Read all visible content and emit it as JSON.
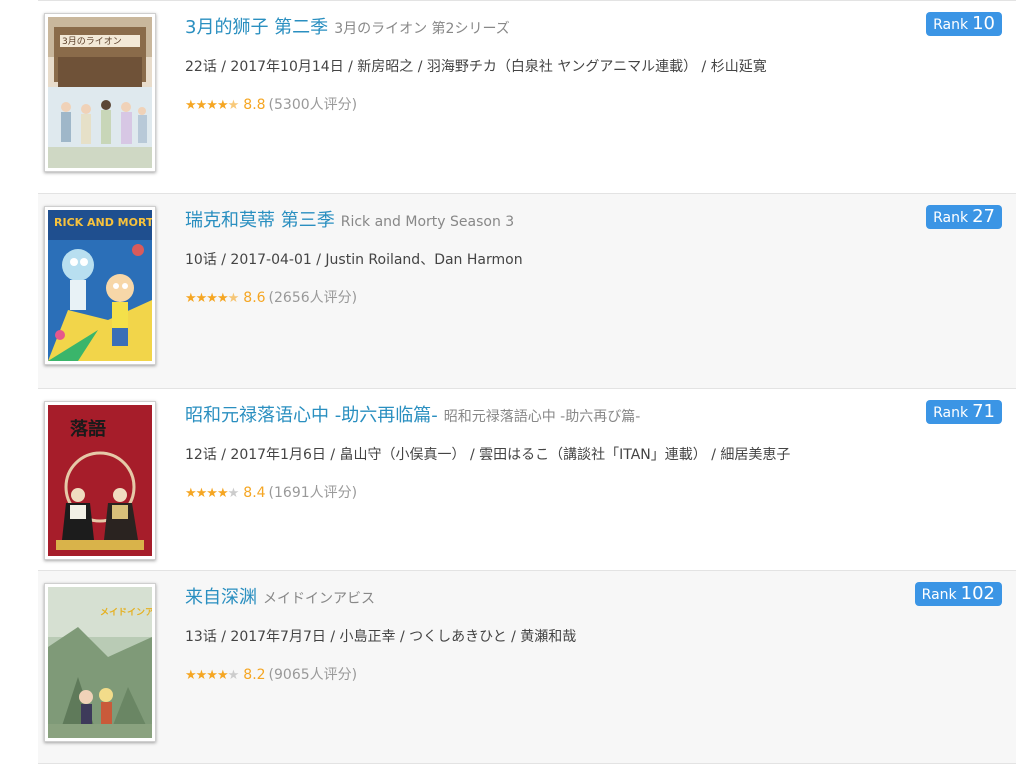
{
  "items": [
    {
      "title_cn": "3月的狮子 第二季",
      "title_orig": "3月のライオン 第2シリーズ",
      "meta": "22话 / 2017年10月14日 / 新房昭之 / 羽海野チカ（白泉社 ヤングアニマル連載） / 杉山延寛",
      "stars": "★★★★",
      "stars_half": "★",
      "stars_empty": "",
      "score": "8.8",
      "count": "(5300人评分)",
      "rank_label": "Rank",
      "rank_num": "10",
      "poster_text": "3月のライオン"
    },
    {
      "title_cn": "瑞克和莫蒂 第三季",
      "title_orig": "Rick and Morty Season 3",
      "meta": "10话 / 2017-04-01 / Justin Roiland、Dan Harmon",
      "stars": "★★★★",
      "stars_half": "★",
      "stars_empty": "",
      "score": "8.6",
      "count": "(2656人评分)",
      "rank_label": "Rank",
      "rank_num": "27",
      "poster_text": "RICK AND MORTY"
    },
    {
      "title_cn": "昭和元禄落语心中 -助六再临篇-",
      "title_orig": "昭和元禄落語心中 -助六再び篇-",
      "meta": "12话 / 2017年1月6日 / 畠山守（小俣真一） / 雲田はるこ（講談社「ITAN」連載） / 細居美恵子",
      "stars": "★★★★",
      "stars_half": "",
      "stars_empty": "★",
      "score": "8.4",
      "count": "(1691人评分)",
      "rank_label": "Rank",
      "rank_num": "71",
      "poster_text": "落語"
    },
    {
      "title_cn": "来自深渊",
      "title_orig": "メイドインアビス",
      "meta": "13话 / 2017年7月7日 / 小島正幸 / つくしあきひと / 黄瀬和哉",
      "stars": "★★★★",
      "stars_half": "",
      "stars_empty": "★",
      "score": "8.2",
      "count": "(9065人评分)",
      "rank_label": "Rank",
      "rank_num": "102",
      "poster_text": "メイドインアビス"
    }
  ]
}
